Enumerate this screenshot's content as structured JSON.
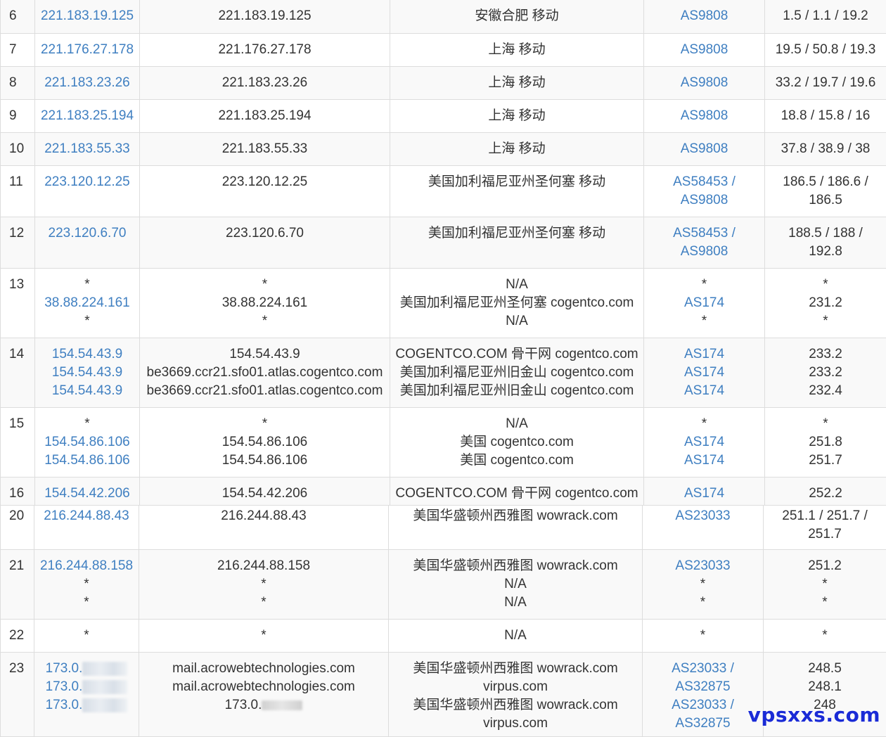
{
  "table_top": {
    "rows": [
      {
        "hop": "6",
        "ip": [
          "221.183.19.125"
        ],
        "host": [
          "221.183.19.125"
        ],
        "loc": [
          "安徽合肥 移动"
        ],
        "asn": [
          "AS9808"
        ],
        "time": [
          "1.5 / 1.1 / 19.2"
        ]
      },
      {
        "hop": "7",
        "ip": [
          "221.176.27.178"
        ],
        "host": [
          "221.176.27.178"
        ],
        "loc": [
          "上海 移动"
        ],
        "asn": [
          "AS9808"
        ],
        "time": [
          "19.5 / 50.8 / 19.3"
        ]
      },
      {
        "hop": "8",
        "ip": [
          "221.183.23.26"
        ],
        "host": [
          "221.183.23.26"
        ],
        "loc": [
          "上海 移动"
        ],
        "asn": [
          "AS9808"
        ],
        "time": [
          "33.2 / 19.7 / 19.6"
        ]
      },
      {
        "hop": "9",
        "ip": [
          "221.183.25.194"
        ],
        "host": [
          "221.183.25.194"
        ],
        "loc": [
          "上海 移动"
        ],
        "asn": [
          "AS9808"
        ],
        "time": [
          "18.8 / 15.8 / 16"
        ]
      },
      {
        "hop": "10",
        "ip": [
          "221.183.55.33"
        ],
        "host": [
          "221.183.55.33"
        ],
        "loc": [
          "上海 移动"
        ],
        "asn": [
          "AS9808"
        ],
        "time": [
          "37.8 / 38.9 / 38"
        ]
      },
      {
        "hop": "11",
        "ip": [
          "223.120.12.25"
        ],
        "host": [
          "223.120.12.25"
        ],
        "loc": [
          "美国加利福尼亚州圣何塞 移动"
        ],
        "asn": [
          "AS58453 /",
          "AS9808"
        ],
        "time": [
          "186.5 / 186.6 /",
          "186.5"
        ]
      },
      {
        "hop": "12",
        "ip": [
          "223.120.6.70"
        ],
        "host": [
          "223.120.6.70"
        ],
        "loc": [
          "美国加利福尼亚州圣何塞 移动"
        ],
        "asn": [
          "AS58453 /",
          "AS9808"
        ],
        "time": [
          "188.5 / 188 /",
          "192.8"
        ]
      },
      {
        "hop": "13",
        "ip": [
          "*",
          "38.88.224.161",
          "*"
        ],
        "host": [
          "*",
          "38.88.224.161",
          "*"
        ],
        "loc": [
          "N/A",
          "美国加利福尼亚州圣何塞 cogentco.com",
          "N/A"
        ],
        "asn": [
          "*",
          "AS174",
          "*"
        ],
        "time": [
          "*",
          "231.2",
          "*"
        ]
      },
      {
        "hop": "14",
        "ip": [
          "154.54.43.9",
          "154.54.43.9",
          "154.54.43.9"
        ],
        "host": [
          "154.54.43.9",
          "be3669.ccr21.sfo01.atlas.cogentco.com",
          "be3669.ccr21.sfo01.atlas.cogentco.com"
        ],
        "loc": [
          "COGENTCO.COM 骨干网 cogentco.com",
          "美国加利福尼亚州旧金山 cogentco.com",
          "美国加利福尼亚州旧金山 cogentco.com"
        ],
        "asn": [
          "AS174",
          "AS174",
          "AS174"
        ],
        "time": [
          "233.2",
          "233.2",
          "232.4"
        ]
      },
      {
        "hop": "15",
        "ip": [
          "*",
          "154.54.86.106",
          "154.54.86.106"
        ],
        "host": [
          "*",
          "154.54.86.106",
          "154.54.86.106"
        ],
        "loc": [
          "N/A",
          "美国 cogentco.com",
          "美国 cogentco.com"
        ],
        "asn": [
          "*",
          "AS174",
          "AS174"
        ],
        "time": [
          "*",
          "251.8",
          "251.7"
        ]
      },
      {
        "hop": "16",
        "ip": [
          "154.54.42.206"
        ],
        "host": [
          "154.54.42.206"
        ],
        "loc": [
          "COGENTCO.COM 骨干网 cogentco.com"
        ],
        "asn": [
          "AS174"
        ],
        "time": [
          "252.2"
        ]
      }
    ]
  },
  "table_bottom": {
    "rows": [
      {
        "hop": "20",
        "ip": [
          "216.244.88.43"
        ],
        "host": [
          "216.244.88.43"
        ],
        "loc": [
          "美国华盛顿州西雅图 wowrack.com"
        ],
        "asn": [
          "AS23033"
        ],
        "time": [
          "251.1 / 251.7 /",
          "251.7"
        ]
      },
      {
        "hop": "21",
        "ip": [
          "216.244.88.158",
          "*",
          "*"
        ],
        "host": [
          "216.244.88.158",
          "*",
          "*"
        ],
        "loc": [
          "美国华盛顿州西雅图 wowrack.com",
          "N/A",
          "N/A"
        ],
        "asn": [
          "AS23033",
          "*",
          "*"
        ],
        "time": [
          "251.2",
          "*",
          "*"
        ]
      },
      {
        "hop": "22",
        "ip": [
          "*"
        ],
        "host": [
          "*"
        ],
        "loc": [
          "N/A"
        ],
        "asn": [
          "*"
        ],
        "time": [
          "*"
        ]
      },
      {
        "hop": "23",
        "ip": [
          "173.0.",
          "173.0.",
          "173.0."
        ],
        "host": [
          "mail.acrowebtechnologies.com",
          "mail.acrowebtechnologies.com",
          "173.0."
        ],
        "loc": [
          "美国华盛顿州西雅图 wowrack.com",
          "virpus.com",
          "美国华盛顿州西雅图 wowrack.com",
          "virpus.com"
        ],
        "asn": [
          "AS23033 /",
          "AS32875",
          "AS23033 /",
          "AS32875"
        ],
        "time": [
          "248.5",
          "248.1",
          "248"
        ]
      }
    ]
  },
  "watermark": "vpsxxs.com"
}
